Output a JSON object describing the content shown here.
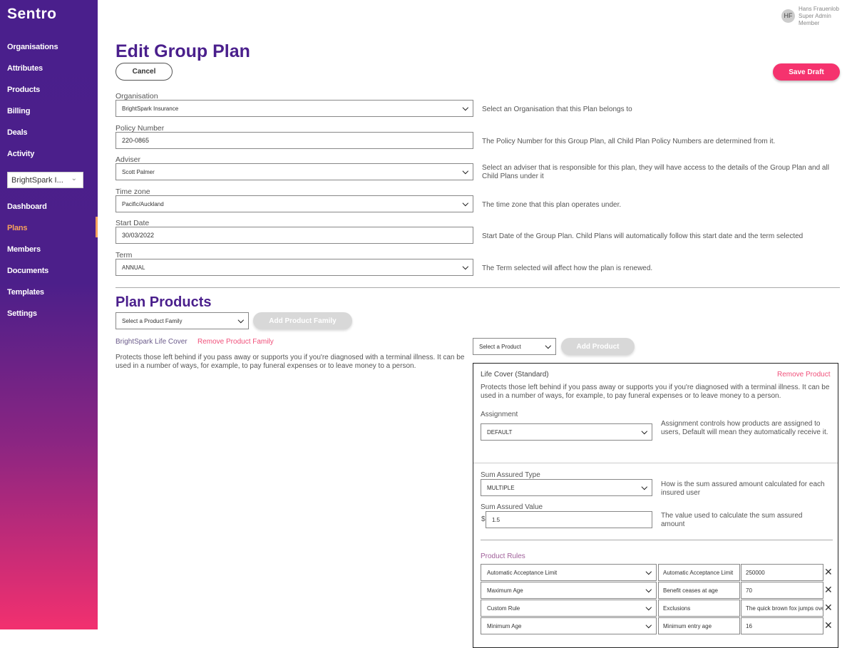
{
  "sidebar": {
    "logo": "Sentro",
    "items_top": [
      "Organisations",
      "Attributes",
      "Products",
      "Billing",
      "Deals",
      "Activity"
    ],
    "org_select": "BrightSpark I...",
    "items_bottom": [
      "Dashboard",
      "Plans",
      "Members",
      "Documents",
      "Templates",
      "Settings"
    ],
    "active": "Plans",
    "accent": "#f7a35c"
  },
  "user": {
    "initials": "HF",
    "name": "Hans Frauenlob",
    "role": "Super Admin",
    "type": "Member"
  },
  "page": {
    "title": "Edit Group Plan",
    "cancel": "Cancel",
    "save": "Save Draft",
    "title_color": "#4a1f8c",
    "save_color": "#f5336e"
  },
  "form": [
    {
      "label": "Organisation",
      "value": "BrightSpark Insurance",
      "type": "select",
      "help": "Select an Organisation that this Plan belongs to"
    },
    {
      "label": "Policy Number",
      "value": "220-0865",
      "type": "text",
      "help": "The Policy Number for this Group Plan, all Child Plan Policy Numbers are determined from it."
    },
    {
      "label": "Adviser",
      "value": "Scott Palmer",
      "type": "select",
      "help": "Select an adviser that is responsible for this plan, they will have access to the details of the Group Plan and all Child Plans under it"
    },
    {
      "label": "Time zone",
      "value": "Pacific/Auckland",
      "type": "select",
      "help": "The time zone that this plan operates under."
    },
    {
      "label": "Start Date",
      "value": "30/03/2022",
      "type": "text",
      "help": "Start Date of the Group Plan. Child Plans will automatically follow this start date and the term selected"
    },
    {
      "label": "Term",
      "value": "ANNUAL",
      "type": "select",
      "help": "The Term selected will affect how the plan is renewed."
    }
  ],
  "products": {
    "title": "Plan Products",
    "family_select": "Select a Product Family",
    "add_family": "Add Product Family",
    "family_name": "BrightSpark Life Cover",
    "remove_family": "Remove Product Family",
    "family_desc": "Protects those left behind if you pass away or supports you if you're diagnosed with a terminal illness. It can be used in a number of ways, for example, to pay funeral expenses or to leave money to a person.",
    "product_select": "Select a Product",
    "add_product": "Add Product",
    "product": {
      "name": "Life Cover (Standard)",
      "remove": "Remove Product",
      "desc": "Protects those left behind if you pass away or supports you if you're diagnosed with a terminal illness. It can be used in a number of ways, for example, to pay funeral expenses or to leave money to a person.",
      "assignment_label": "Assignment",
      "assignment": "DEFAULT",
      "assignment_help": "Assignment controls how products are assigned to users, Default will mean they automatically receive it.",
      "sat_label": "Sum Assured Type",
      "sat": "MULTIPLE",
      "sat_help": "How is the sum assured amount calculated for each insured user",
      "sav_label": "Sum Assured Value",
      "currency": "$",
      "sav": "1.5",
      "sav_help": "The value used to calculate the sum assured amount",
      "rules_label": "Product Rules",
      "rules": [
        {
          "type": "Automatic Acceptance Limit",
          "name": "Automatic Acceptance Limit",
          "value": "250000"
        },
        {
          "type": "Maximum Age",
          "name": "Benefit ceases at age",
          "value": "70"
        },
        {
          "type": "Custom Rule",
          "name": "Exclusions",
          "value": "The quick brown fox jumps over"
        },
        {
          "type": "Minimum Age",
          "name": "Minimum entry age",
          "value": "16"
        }
      ]
    }
  }
}
